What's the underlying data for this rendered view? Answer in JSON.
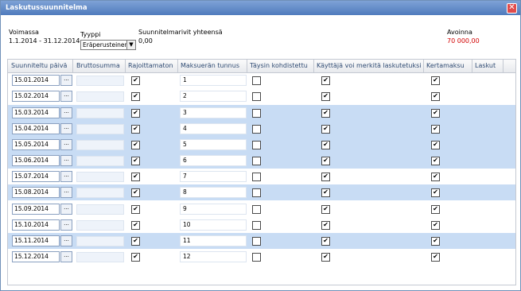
{
  "window": {
    "title": "Laskutussuunnitelma"
  },
  "summary": {
    "valid_label": "Voimassa",
    "valid_value": "1.1.2014 - 31.12.2014",
    "type_label": "Tyyppi",
    "type_value": "Eräperusteinen",
    "rows_total_label": "Suunnitelmarivit yhteensä",
    "rows_total_value": "0,00",
    "open_label": "Avoinna",
    "open_value": "70 000,00"
  },
  "columns": [
    "Suunniteltu päivä",
    "Bruttosumma",
    "Rajoittamaton",
    "Maksuerän tunnus",
    "Täysin kohdistettu",
    "Käyttäjä voi merkitä laskutetuksi",
    "Kertamaksu",
    "Laskut"
  ],
  "rows": [
    {
      "date": "15.01.2014",
      "id": "1"
    },
    {
      "date": "15.02.2014",
      "id": "2"
    },
    {
      "date": "15.03.2014",
      "id": "3"
    },
    {
      "date": "15.04.2014",
      "id": "4"
    },
    {
      "date": "15.05.2014",
      "id": "5"
    },
    {
      "date": "15.06.2014",
      "id": "6"
    },
    {
      "date": "15.07.2014",
      "id": "7"
    },
    {
      "date": "15.08.2014",
      "id": "8"
    },
    {
      "date": "15.09.2014",
      "id": "9"
    },
    {
      "date": "15.10.2014",
      "id": "10"
    },
    {
      "date": "15.11.2014",
      "id": "11"
    },
    {
      "date": "15.12.2014",
      "id": "12"
    }
  ],
  "row_flags": {
    "unrestricted": true,
    "fully_allocated": false,
    "user_can_mark_invoiced": true,
    "one_time_fee": true
  },
  "glyphs": {
    "check": "✔",
    "close": "✕",
    "dropdown": "▼",
    "ellipsis": "..."
  },
  "colors": {
    "titlebar": "#4f7bbd",
    "row_highlight": "#c8dcf4",
    "open_amount": "#d20000"
  }
}
